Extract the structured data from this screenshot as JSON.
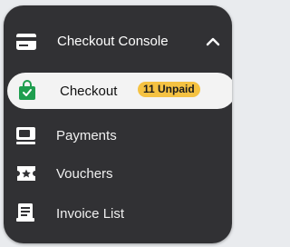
{
  "header": {
    "title": "Checkout Console",
    "icon": "card-icon",
    "toggle_icon": "chevron-up-icon"
  },
  "items": [
    {
      "label": "Checkout",
      "icon": "shopping-bag-icon",
      "badge": "11 Unpaid",
      "active": true
    },
    {
      "label": "Payments",
      "icon": "payment-icon"
    },
    {
      "label": "Vouchers",
      "icon": "voucher-icon"
    },
    {
      "label": "Invoice List",
      "icon": "invoice-icon"
    }
  ],
  "colors": {
    "panel": "#313134",
    "active_background": "#f3f3f3",
    "bag_green": "#1f9e4f",
    "badge": "#f5c242",
    "text": "#ffffff"
  }
}
